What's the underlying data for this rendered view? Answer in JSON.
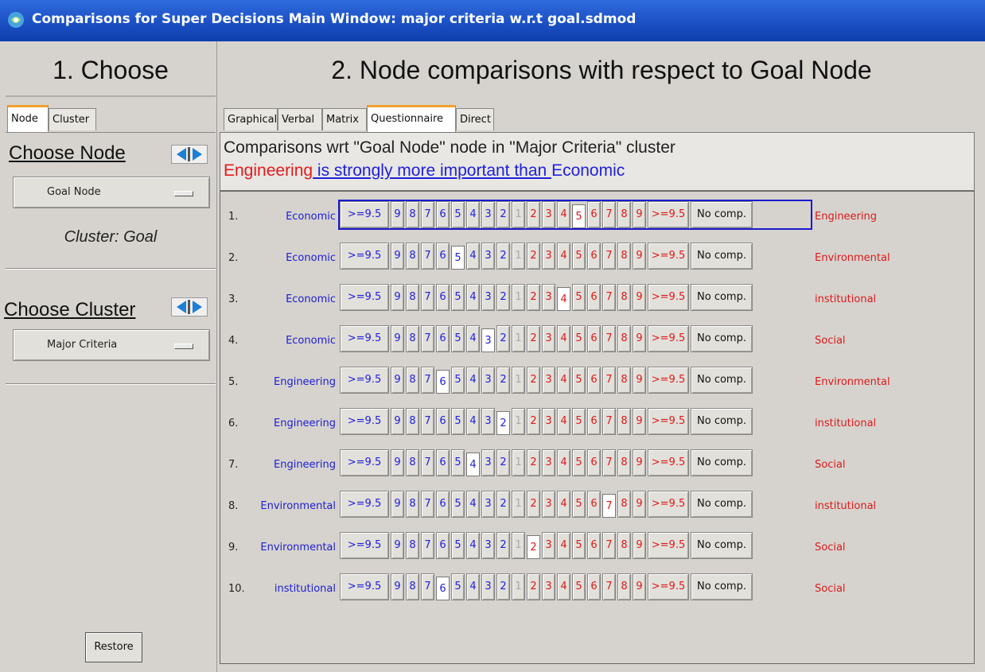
{
  "window": {
    "title": "Comparisons for Super Decisions Main Window: major criteria w.r.t goal.sdmod"
  },
  "left": {
    "heading": "1. Choose",
    "tabs": [
      "Node",
      "Cluster"
    ],
    "choose_node_title": "Choose Node",
    "node_value": "Goal Node",
    "cluster_label": "Cluster: Goal",
    "choose_cluster_title": "Choose Cluster",
    "cluster_value": "Major Criteria",
    "restore_label": "Restore"
  },
  "right": {
    "heading": "2. Node comparisons with respect to Goal Node",
    "tabs": [
      "Graphical",
      "Verbal",
      "Matrix",
      "Questionnaire",
      "Direct"
    ],
    "active_tab": "Questionnaire",
    "message_line1": "Comparisons wrt \"Goal Node\" node in \"Major Criteria\" cluster",
    "message_red": "Engineering",
    "message_blue1": " is strongly more important than ",
    "message_blue2": "Economic"
  },
  "scale": {
    "left": [
      ">=9.5",
      "9",
      "8",
      "7",
      "6",
      "5",
      "4",
      "3",
      "2"
    ],
    "center": "1",
    "right": [
      "2",
      "3",
      "4",
      "5",
      "6",
      "7",
      "8",
      "9",
      ">=9.5"
    ],
    "no_comp": "No comp."
  },
  "comparisons": [
    {
      "num": "1.",
      "left": "Economic",
      "right": "Engineering",
      "selected_side": "right",
      "selected_value": "5",
      "focused": true
    },
    {
      "num": "2.",
      "left": "Economic",
      "right": "Environmental",
      "selected_side": "left",
      "selected_value": "5",
      "focused": false
    },
    {
      "num": "3.",
      "left": "Economic",
      "right": "institutional",
      "selected_side": "right",
      "selected_value": "4",
      "focused": false
    },
    {
      "num": "4.",
      "left": "Economic",
      "right": "Social",
      "selected_side": "left",
      "selected_value": "3",
      "focused": false
    },
    {
      "num": "5.",
      "left": "Engineering",
      "right": "Environmental",
      "selected_side": "left",
      "selected_value": "6",
      "focused": false
    },
    {
      "num": "6.",
      "left": "Engineering",
      "right": "institutional",
      "selected_side": "left",
      "selected_value": "2",
      "focused": false
    },
    {
      "num": "7.",
      "left": "Engineering",
      "right": "Social",
      "selected_side": "left",
      "selected_value": "4",
      "focused": false
    },
    {
      "num": "8.",
      "left": "Environmental",
      "right": "institutional",
      "selected_side": "right",
      "selected_value": "7",
      "focused": false
    },
    {
      "num": "9.",
      "left": "Environmental",
      "right": "Social",
      "selected_side": "right",
      "selected_value": "2",
      "focused": false
    },
    {
      "num": "10.",
      "left": "institutional",
      "right": "Social",
      "selected_side": "left",
      "selected_value": "6",
      "focused": false
    }
  ]
}
